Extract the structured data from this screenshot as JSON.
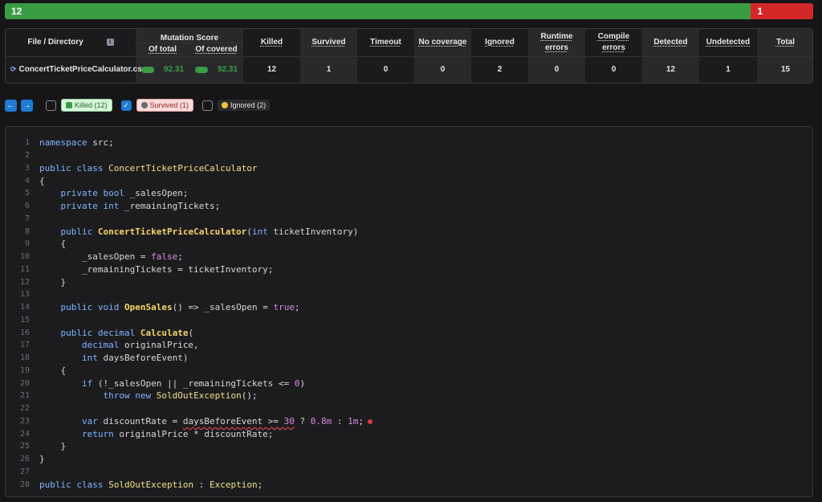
{
  "progress": {
    "killed_label": "12",
    "survived_label": "1",
    "killed_fraction": 0.923,
    "colors": {
      "killed": "#3a9d44",
      "survived": "#d42828"
    }
  },
  "metrics": {
    "headers": {
      "file": "File / Directory",
      "mutation_score": "Mutation Score",
      "of_total": "Of total",
      "of_covered": "Of covered",
      "killed": "Killed",
      "survived": "Survived",
      "timeout": "Timeout",
      "no_coverage": "No coverage",
      "ignored": "Ignored",
      "runtime_errors": "Runtime errors",
      "compile_errors": "Compile errors",
      "detected": "Detected",
      "undetected": "Undetected",
      "total": "Total"
    },
    "row": {
      "file": "ConcertTicketPriceCalculator.cs",
      "of_total": "92.31",
      "of_covered": "92.31",
      "killed": "12",
      "survived": "1",
      "timeout": "0",
      "no_coverage": "0",
      "ignored": "2",
      "runtime_errors": "0",
      "compile_errors": "0",
      "detected": "12",
      "undetected": "1",
      "total": "15"
    }
  },
  "filters": {
    "prev_icon": "arrow-left-icon",
    "next_icon": "arrow-right-icon",
    "killed": {
      "label": "Killed (12)",
      "checked": false
    },
    "survived": {
      "label": "Survived (1)",
      "checked": true
    },
    "ignored": {
      "label": "Ignored (2)",
      "checked": false
    }
  },
  "code": {
    "lines": [
      "namespace src;",
      "",
      "public class ConcertTicketPriceCalculator",
      "{",
      "    private bool _salesOpen;",
      "    private int _remainingTickets;",
      "",
      "    public ConcertTicketPriceCalculator(int ticketInventory)",
      "    {",
      "        _salesOpen = false;",
      "        _remainingTickets = ticketInventory;",
      "    }",
      "",
      "    public void OpenSales() => _salesOpen = true;",
      "",
      "    public decimal Calculate(",
      "        decimal originalPrice,",
      "        int daysBeforeEvent)",
      "    {",
      "        if (!_salesOpen || _remainingTickets <= 0)",
      "            throw new SoldOutException();",
      "",
      "        var discountRate = daysBeforeEvent >= 30 ? 0.8m : 1m;",
      "        return originalPrice * discountRate;",
      "    }",
      "}",
      "",
      "public class SoldOutException : Exception;"
    ]
  }
}
